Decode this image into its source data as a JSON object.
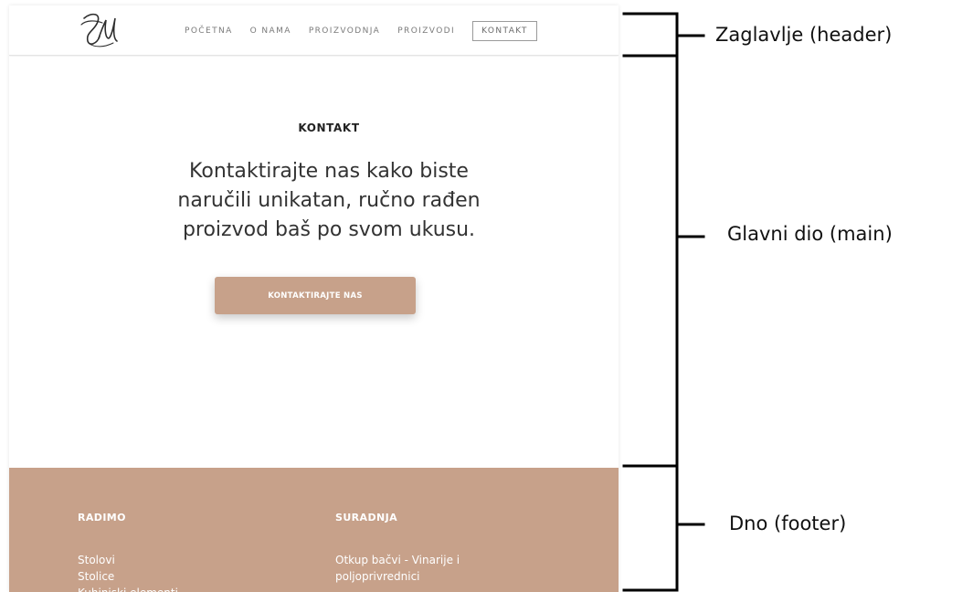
{
  "header": {
    "logo_icon": "cursive-monogram-logo",
    "nav": [
      "POČETNA",
      "O NAMA",
      "PROIZVODNJA",
      "PROIZVODI",
      "KONTAKT"
    ],
    "active_nav": "KONTAKT"
  },
  "main": {
    "section_title": "KONTAKT",
    "headline_lines": [
      "Kontaktirajte nas kako biste",
      "naručili unikatan, ručno rađen",
      "proizvod baš po svom ukusu."
    ],
    "cta_label": "KONTAKTIRAJTE NAS"
  },
  "footer": {
    "col1": {
      "heading": "RADIMO",
      "links": [
        "Stolovi",
        "Stolice",
        "Kuhinjski elementi"
      ]
    },
    "col2": {
      "heading": "SURADNJA",
      "links": [
        "Otkup bačvi - Vinarije i",
        "poljoprivrednici"
      ]
    }
  },
  "annotations": {
    "header": "Zaglavlje (header)",
    "main": "Glavni dio (main)",
    "footer": "Dno (footer)"
  },
  "colors": {
    "accent": "#c7a18a",
    "text_dark": "#222222",
    "nav_text": "#7a7a7a"
  }
}
